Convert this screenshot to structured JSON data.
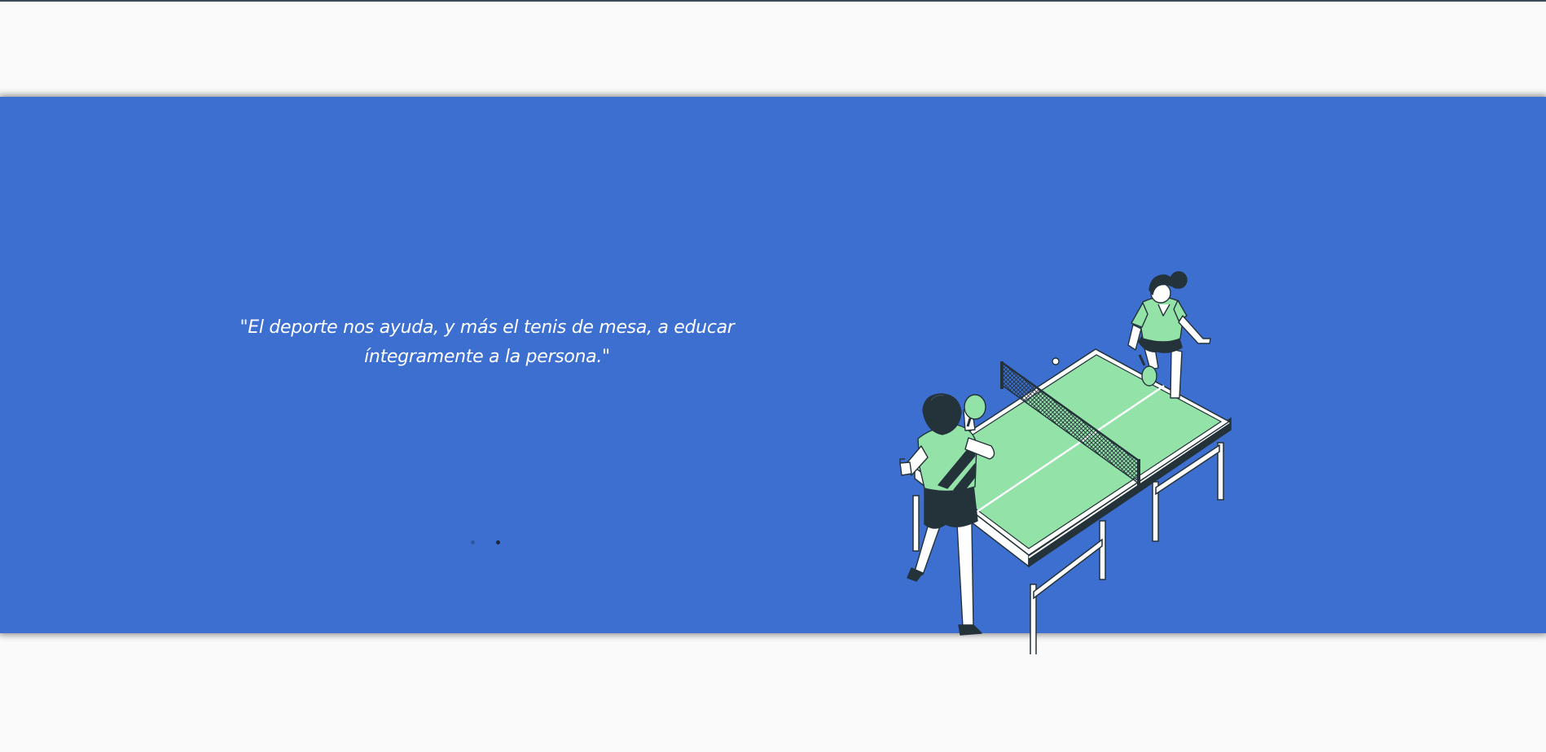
{
  "hero": {
    "quote": "\"El deporte nos ayuda, y más el tenis de mesa, a educar íntegramente a la persona.\"",
    "accent_color": "#3c6fcf",
    "carousel": {
      "active_index": 1,
      "count": 2
    },
    "illustration": {
      "icon": "table-tennis-players-illustration",
      "table_color": "#93e2a8",
      "ink_color": "#24323a"
    }
  }
}
